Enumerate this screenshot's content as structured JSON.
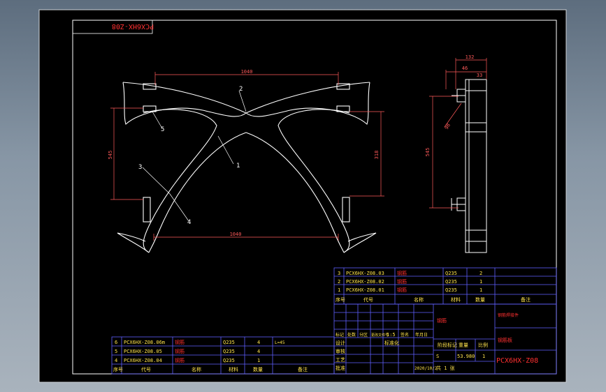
{
  "title_stamp": "PCX6HX-Z08",
  "dims": {
    "top_width": "1040",
    "bottom_width": "1040",
    "left_height": "545",
    "right_height": "318",
    "side_height": "545",
    "side_total": "132",
    "side_a": "46",
    "side_b": "33",
    "side_c": "98"
  },
  "balloons": [
    "1",
    "2",
    "3",
    "4",
    "5"
  ],
  "upper_bom": {
    "rows": [
      {
        "no": "3",
        "code": "PCX6HX-Z08.03",
        "name": "钢筋",
        "mat": "Q235",
        "qty": "2"
      },
      {
        "no": "2",
        "code": "PCX6HX-Z08.02",
        "name": "钢筋",
        "mat": "Q235",
        "qty": "1"
      },
      {
        "no": "1",
        "code": "PCX6HX-Z08.01",
        "name": "钢筋",
        "mat": "Q235",
        "qty": "1"
      }
    ],
    "header": {
      "no": "序号",
      "code": "代号",
      "name": "名称",
      "mat": "材料",
      "qty": "数量",
      "note": "备注"
    }
  },
  "lower_bom": {
    "rows": [
      {
        "no": "6",
        "code": "PCX6HX-Z08.06m",
        "name": "钢筋",
        "mat": "Q235",
        "qty": "4",
        "note": "L=45"
      },
      {
        "no": "5",
        "code": "PCX6HX-Z08.05",
        "name": "钢筋",
        "mat": "Q235",
        "qty": "4",
        "note": ""
      },
      {
        "no": "4",
        "code": "PCX6HX-Z08.04",
        "name": "钢筋",
        "mat": "Q235",
        "qty": "1",
        "note": ""
      }
    ],
    "header": {
      "no": "序号",
      "code": "代号",
      "name": "名称",
      "mat": "材料",
      "qty": "数量",
      "note": "备注"
    }
  },
  "title_block": {
    "material": "钢筋",
    "company": "钢筋焊接件",
    "part_name": "钢筋板",
    "drawing_no": "PCX6HX-Z08",
    "scale_label": "比例",
    "weight_label": "重量",
    "stage_label": "阶段标记",
    "scale": "1:5",
    "sheet": "S",
    "weight": "53.980",
    "sheet_count": "1",
    "date": "2020/10/2",
    "sheet_text": "共 1 张",
    "designer_label": "设计",
    "check_label": "审核",
    "process_label": "工艺",
    "standard_label": "标准化",
    "approve_label": "批准",
    "mark_label": "标记",
    "count_label": "处数",
    "zone_label": "分区",
    "doc_label": "更改文件号",
    "sign_label": "签名",
    "date_label": "年月日"
  },
  "colors": {
    "paper": "#000000",
    "line": "#ffffff",
    "dim": "#ff5a5a",
    "table": "#5f5fff",
    "text_yellow": "#ffe34d",
    "text_red": "#ff3030"
  }
}
